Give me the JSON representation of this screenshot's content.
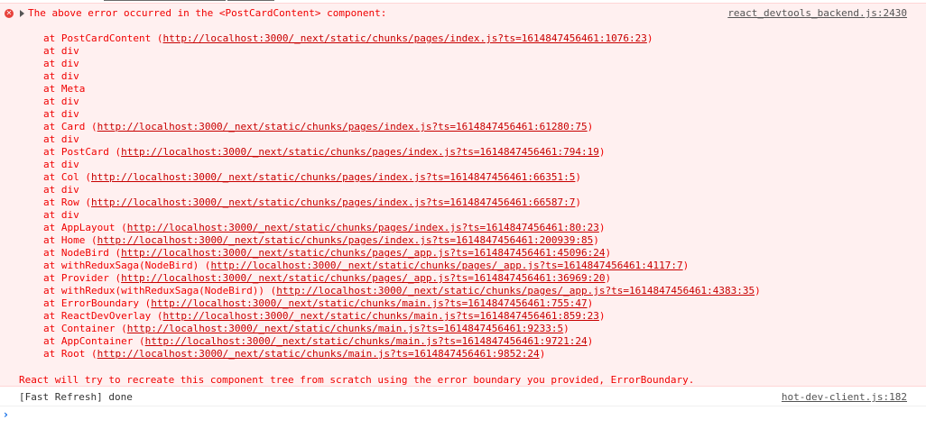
{
  "error": {
    "title": "The above error occurred in the <PostCardContent> component:",
    "source": "react_devtools_backend.js:2430",
    "stack": [
      {
        "label": "at PostCardContent (",
        "url": "http://localhost:3000/_next/static/chunks/pages/index.js?ts=1614847456461:1076:23",
        "suffix": ")"
      },
      {
        "label": "at div",
        "url": "",
        "suffix": ""
      },
      {
        "label": "at div",
        "url": "",
        "suffix": ""
      },
      {
        "label": "at div",
        "url": "",
        "suffix": ""
      },
      {
        "label": "at Meta",
        "url": "",
        "suffix": ""
      },
      {
        "label": "at div",
        "url": "",
        "suffix": ""
      },
      {
        "label": "at div",
        "url": "",
        "suffix": ""
      },
      {
        "label": "at Card (",
        "url": "http://localhost:3000/_next/static/chunks/pages/index.js?ts=1614847456461:61280:75",
        "suffix": ")"
      },
      {
        "label": "at div",
        "url": "",
        "suffix": ""
      },
      {
        "label": "at PostCard (",
        "url": "http://localhost:3000/_next/static/chunks/pages/index.js?ts=1614847456461:794:19",
        "suffix": ")"
      },
      {
        "label": "at div",
        "url": "",
        "suffix": ""
      },
      {
        "label": "at Col (",
        "url": "http://localhost:3000/_next/static/chunks/pages/index.js?ts=1614847456461:66351:5",
        "suffix": ")"
      },
      {
        "label": "at div",
        "url": "",
        "suffix": ""
      },
      {
        "label": "at Row (",
        "url": "http://localhost:3000/_next/static/chunks/pages/index.js?ts=1614847456461:66587:7",
        "suffix": ")"
      },
      {
        "label": "at div",
        "url": "",
        "suffix": ""
      },
      {
        "label": "at AppLayout (",
        "url": "http://localhost:3000/_next/static/chunks/pages/index.js?ts=1614847456461:80:23",
        "suffix": ")"
      },
      {
        "label": "at Home (",
        "url": "http://localhost:3000/_next/static/chunks/pages/index.js?ts=1614847456461:200939:85",
        "suffix": ")"
      },
      {
        "label": "at NodeBird (",
        "url": "http://localhost:3000/_next/static/chunks/pages/_app.js?ts=1614847456461:45096:24",
        "suffix": ")"
      },
      {
        "label": "at withReduxSaga(NodeBird) (",
        "url": "http://localhost:3000/_next/static/chunks/pages/_app.js?ts=1614847456461:4117:7",
        "suffix": ")"
      },
      {
        "label": "at Provider (",
        "url": "http://localhost:3000/_next/static/chunks/pages/_app.js?ts=1614847456461:36969:20",
        "suffix": ")"
      },
      {
        "label": "at withRedux(withReduxSaga(NodeBird)) (",
        "url": "http://localhost:3000/_next/static/chunks/pages/_app.js?ts=1614847456461:4383:35",
        "suffix": ")"
      },
      {
        "label": "at ErrorBoundary (",
        "url": "http://localhost:3000/_next/static/chunks/main.js?ts=1614847456461:755:47",
        "suffix": ")"
      },
      {
        "label": "at ReactDevOverlay (",
        "url": "http://localhost:3000/_next/static/chunks/main.js?ts=1614847456461:859:23",
        "suffix": ")"
      },
      {
        "label": "at Container (",
        "url": "http://localhost:3000/_next/static/chunks/main.js?ts=1614847456461:9233:5",
        "suffix": ")"
      },
      {
        "label": "at AppContainer (",
        "url": "http://localhost:3000/_next/static/chunks/main.js?ts=1614847456461:9721:24",
        "suffix": ")"
      },
      {
        "label": "at Root (",
        "url": "http://localhost:3000/_next/static/chunks/main.js?ts=1614847456461:9852:24",
        "suffix": ")"
      }
    ],
    "footer": "React will try to recreate this component tree from scratch using the error boundary you provided, ErrorBoundary."
  },
  "log": {
    "text": "[Fast Refresh] done",
    "source": "hot-dev-client.js:182"
  },
  "icons": {
    "error": "error-circle-icon",
    "expand": "expand-triangle-icon",
    "prompt": "chevron-right-icon"
  },
  "colors": {
    "error_text": "#f00000",
    "error_background": "#fff0f0",
    "error_border": "#ffd6d6",
    "prompt": "#1a73e8",
    "link": "#545454"
  }
}
